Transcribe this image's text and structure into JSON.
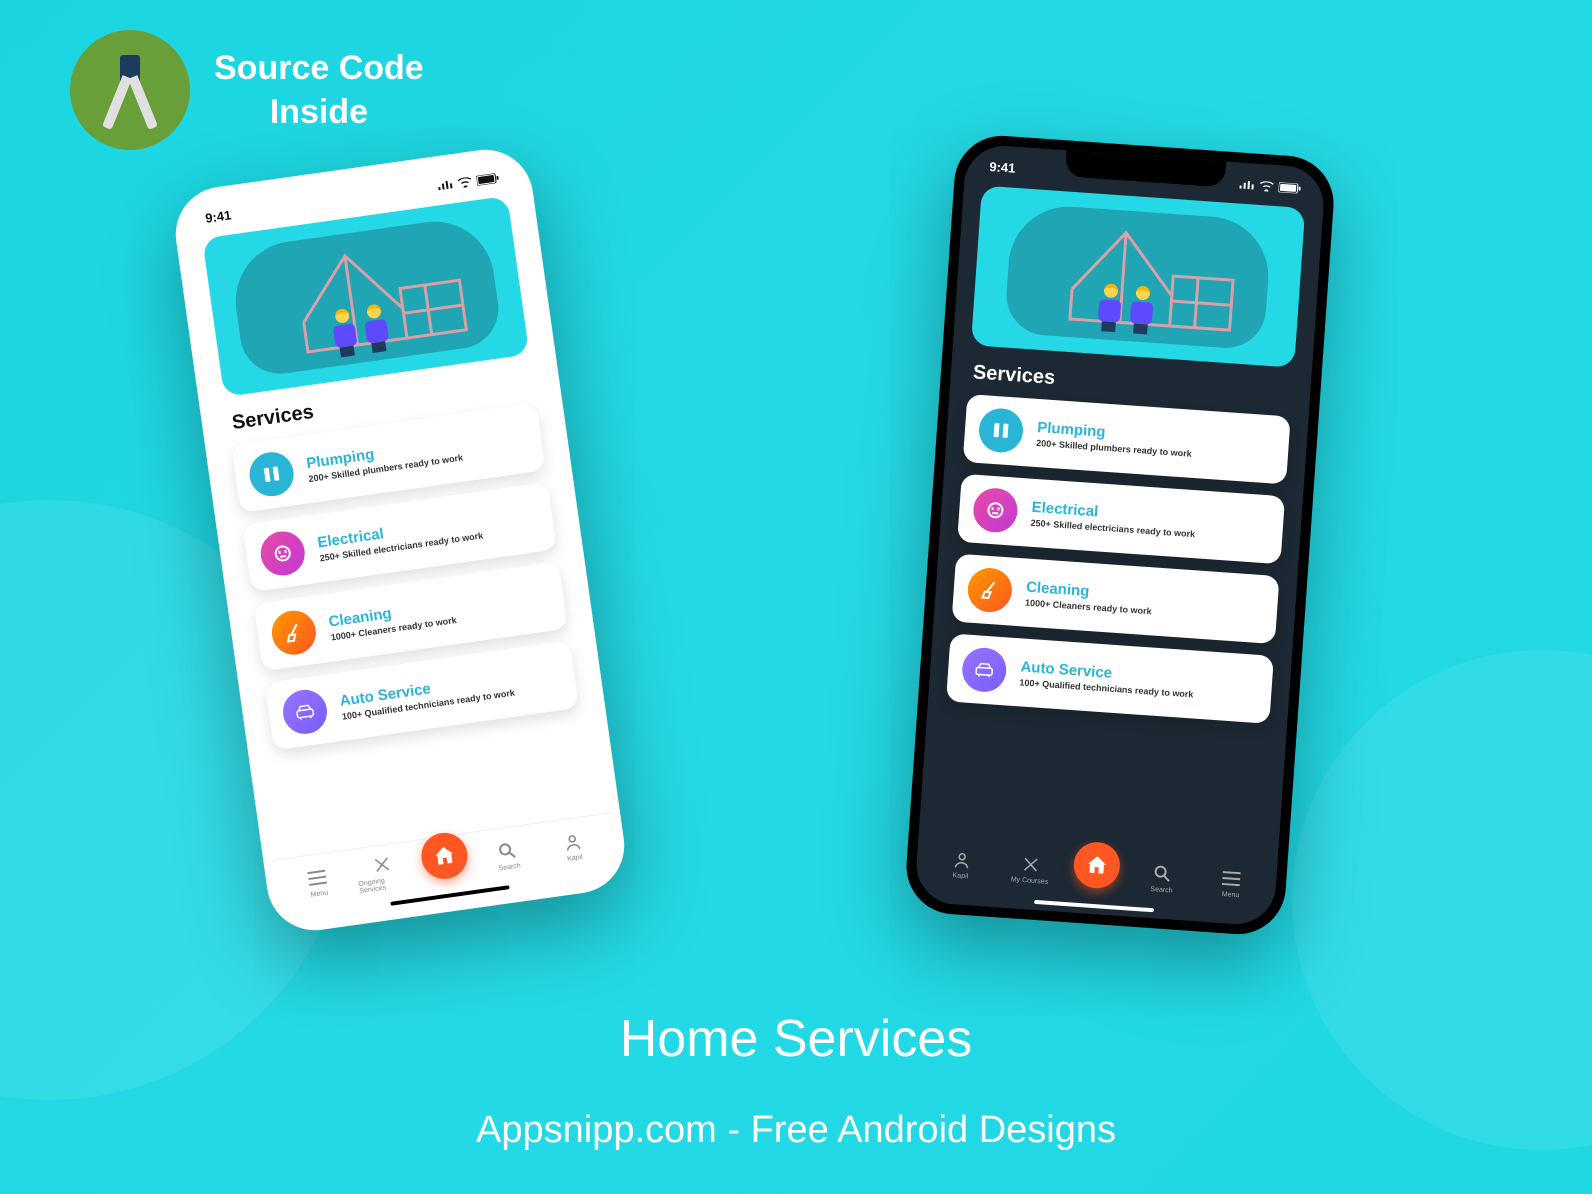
{
  "header": {
    "line1": "Source Code",
    "line2": "Inside"
  },
  "status": {
    "time": "9:41"
  },
  "section_title": "Services",
  "services": [
    {
      "title": "Plumping",
      "sub": "200+ Skilled plumbers ready to work",
      "icon": "wrench"
    },
    {
      "title": "Electrical",
      "sub": "250+ Skilled electricians ready to work",
      "icon": "plug"
    },
    {
      "title": "Cleaning",
      "sub": "1000+ Cleaners ready to work",
      "icon": "broom"
    },
    {
      "title": "Auto Service",
      "sub": "100+ Qualified technicians ready to work",
      "icon": "car"
    }
  ],
  "nav_light": [
    {
      "label": "Menu"
    },
    {
      "label": "Ongoing Services"
    },
    {
      "label": ""
    },
    {
      "label": "Search"
    },
    {
      "label": "Kapil"
    }
  ],
  "nav_dark": [
    {
      "label": "Kapil"
    },
    {
      "label": "My Courses"
    },
    {
      "label": ""
    },
    {
      "label": "Search"
    },
    {
      "label": "Menu"
    }
  ],
  "caption": {
    "main": "Home Services",
    "sub": "Appsnipp.com - Free Android Designs"
  },
  "colors": {
    "accent": "#29b6d6",
    "home_btn": "#ff5722"
  }
}
